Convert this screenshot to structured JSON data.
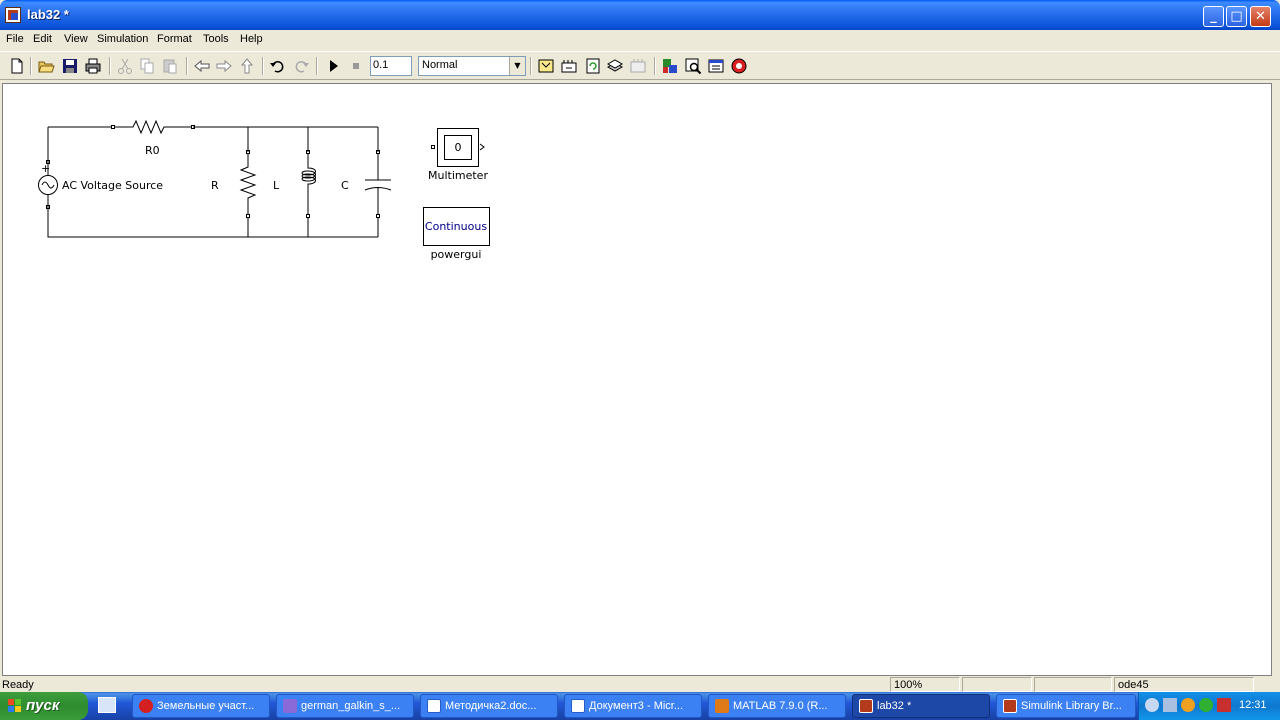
{
  "window": {
    "title": "lab32 *"
  },
  "menubar": [
    "File",
    "Edit",
    "View",
    "Simulation",
    "Format",
    "Tools",
    "Help"
  ],
  "toolbar": {
    "stop_time": "0.1",
    "sim_mode": "Normal",
    "icons": [
      "new-model-icon",
      "open-icon",
      "save-icon",
      "print-icon",
      "cut-icon",
      "copy-icon",
      "paste-icon",
      "back-icon",
      "forward-icon",
      "up-icon",
      "undo-icon",
      "redo-icon",
      "start-simulation-icon",
      "stop-simulation-icon",
      "build-icon",
      "update-diagram-icon",
      "refresh-icon",
      "library-browser-icon",
      "model-explorer-icon",
      "debugger-icon",
      "find-icon",
      "model-advisor-icon",
      "lock-icon"
    ]
  },
  "diagram": {
    "blocks": {
      "source": "AC Voltage Source",
      "r0": "R0",
      "r": "R",
      "l": "L",
      "c": "C",
      "multimeter": "Multimeter",
      "multimeter_value": "0",
      "powergui_text": "Continuous",
      "powergui": "powergui"
    }
  },
  "statusbar": {
    "status": "Ready",
    "zoom": "100%",
    "solver": "ode45"
  },
  "taskbar": {
    "start": "пуск",
    "tasks": [
      {
        "label": "Земельные участ...",
        "color": "#d42020"
      },
      {
        "label": "german_galkin_s_...",
        "color": "#8a6ad8"
      },
      {
        "label": "Методичка2.doc...",
        "color": "#2a5cc8"
      },
      {
        "label": "Документ3 - Micr...",
        "color": "#2a5cc8"
      },
      {
        "label": "MATLAB  7.9.0 (R...",
        "color": "#e07a18"
      },
      {
        "label": "lab32 *",
        "color": "#b43a1c"
      },
      {
        "label": "Simulink Library Br...",
        "color": "#b43a1c"
      }
    ],
    "clock": "12:31"
  }
}
